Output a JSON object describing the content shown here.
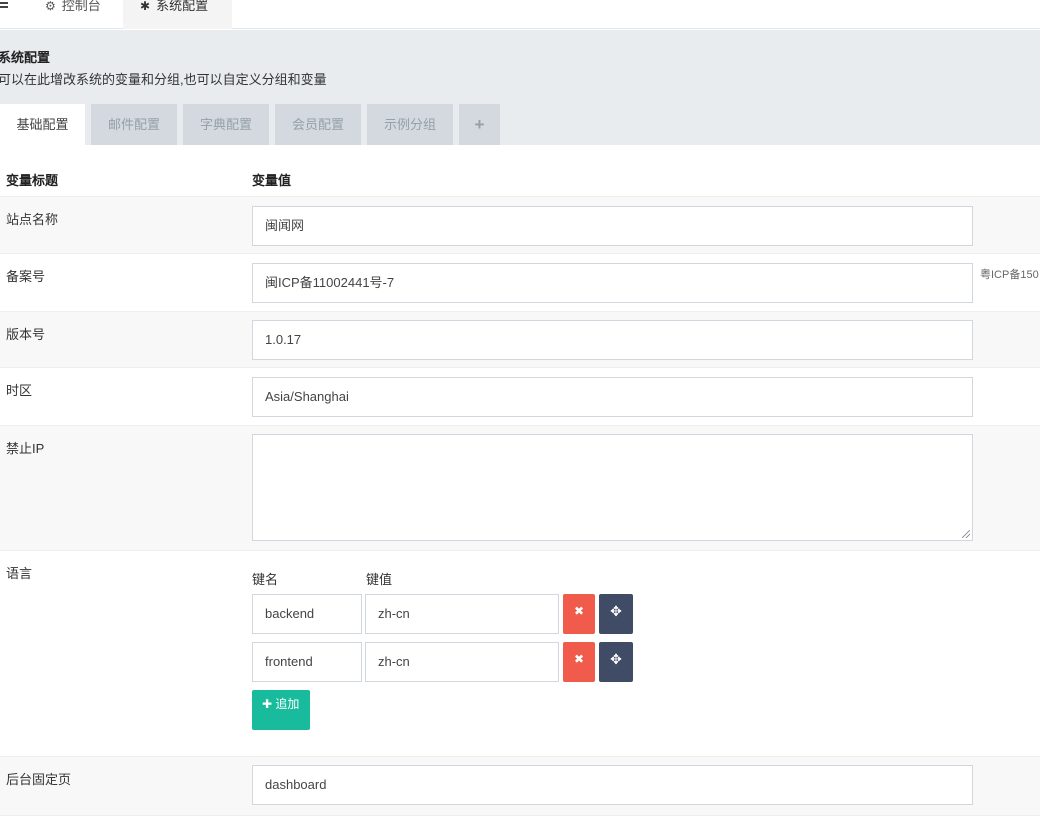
{
  "topbar": {
    "tabs": [
      {
        "label": "控制台",
        "icon": "dashboard-icon"
      },
      {
        "label": "系统配置",
        "icon": "gear-icon"
      }
    ]
  },
  "header": {
    "title": "系统配置",
    "description": "可以在此增改系统的变量和分组,也可以自定义分组和变量"
  },
  "group_tabs": [
    "基础配置",
    "邮件配置",
    "字典配置",
    "会员配置",
    "示例分组",
    "+"
  ],
  "table": {
    "col_title": "变量标题",
    "col_value": "变量值",
    "rows": [
      {
        "label": "站点名称",
        "value": "闽闻网"
      },
      {
        "label": "备案号",
        "value": "闽ICP备11002441号-7",
        "hint": "粤ICP备150"
      },
      {
        "label": "版本号",
        "value": "1.0.17"
      },
      {
        "label": "时区",
        "value": "Asia/Shanghai"
      },
      {
        "label": "禁止IP",
        "value": ""
      }
    ],
    "language": {
      "label": "语言",
      "key_header": "键名",
      "value_header": "键值",
      "pairs": [
        {
          "key": "backend",
          "value": "zh-cn"
        },
        {
          "key": "frontend",
          "value": "zh-cn"
        }
      ],
      "add_label": "追加"
    },
    "fixed_page": {
      "label": "后台固定页",
      "value": "dashboard"
    }
  },
  "colors": {
    "add": "#18bc9c",
    "delete": "#f05b4b",
    "move": "#404b66",
    "header_bg": "#e8ecef"
  }
}
